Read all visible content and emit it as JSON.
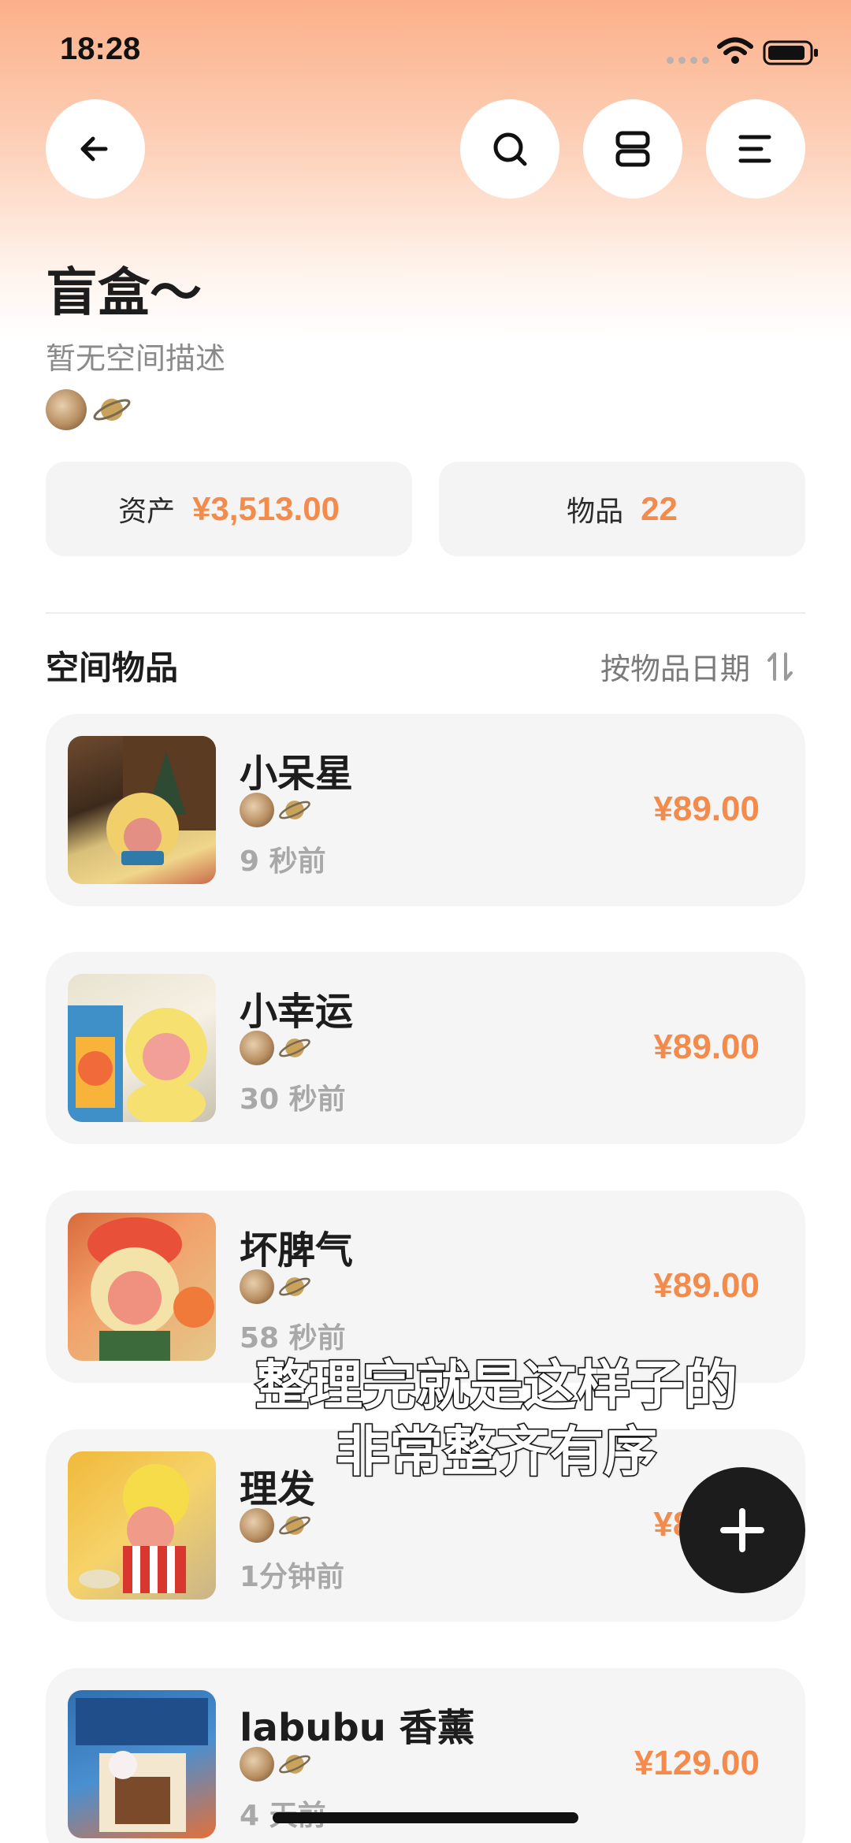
{
  "status_bar": {
    "time": "18:28"
  },
  "toolbar": {
    "back_icon": "arrow-left-icon",
    "search_icon": "search-icon",
    "view_icon": "layout-toggle-icon",
    "menu_icon": "menu-icon"
  },
  "space": {
    "title": "盲盒～",
    "description": "暂无空间描述"
  },
  "stats": {
    "assets_label": "资产",
    "assets_value": "¥3,513.00",
    "items_label": "物品",
    "items_value": "22"
  },
  "section": {
    "title": "空间物品",
    "sort_label": "按物品日期",
    "sort_icon": "sort-arrows-icon"
  },
  "items": [
    {
      "name": "小呆星",
      "time": "9 秒前",
      "price": "¥89.00"
    },
    {
      "name": "小幸运",
      "time": "30 秒前",
      "price": "¥89.00"
    },
    {
      "name": "坏脾气",
      "time": "58 秒前",
      "price": "¥89.00"
    },
    {
      "name": "理发",
      "time": "1分钟前",
      "price": "¥89.00"
    },
    {
      "name": "labubu 香薰",
      "time": "4 天前",
      "price": "¥129.00"
    }
  ],
  "overlay": {
    "line1": "整理完就是这样子的",
    "line2": "非常整齐有序"
  },
  "fab": {
    "icon": "plus-icon"
  },
  "colors": {
    "accent": "#f28b4c",
    "header_gradient": "#fbb089",
    "card_bg": "#f5f5f5",
    "fab": "#1c1c1c"
  }
}
